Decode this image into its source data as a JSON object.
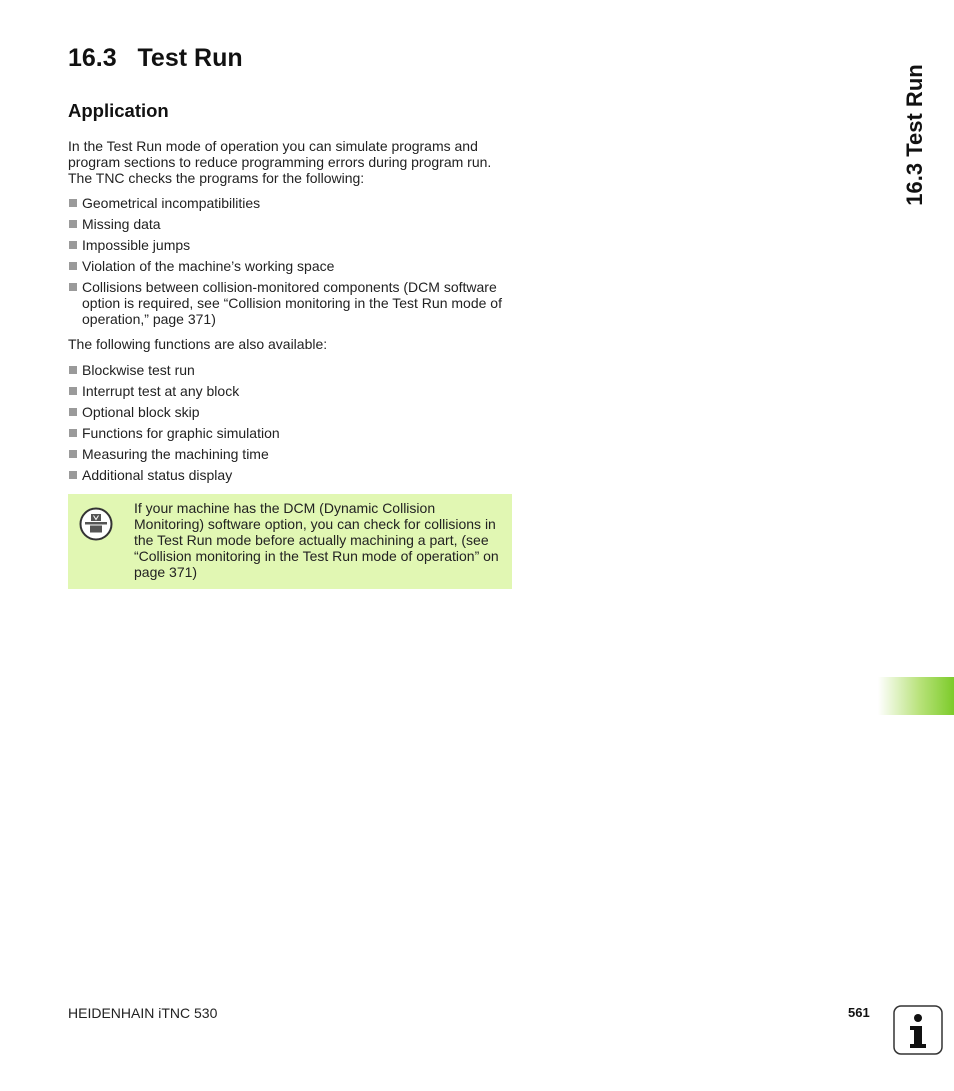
{
  "chapter": {
    "number": "16.3",
    "title": "Test Run"
  },
  "section": {
    "title": "Application"
  },
  "intro": "In the Test Run mode of operation you can simulate programs and program sections to reduce programming errors during program run. The TNC checks the programs for the following:",
  "checks": [
    {
      "label": "Geometrical incompatibilities"
    },
    {
      "label": "Missing data"
    },
    {
      "label": "Impossible jumps"
    },
    {
      "label": "Violation of the machine’s working space"
    },
    {
      "label": "Collisions between collision-monitored components (DCM software option is required, see “Collision monitoring in the Test Run mode of operation,” page 371)"
    }
  ],
  "also_available": "The following functions are also available:",
  "functions": [
    {
      "label": "Blockwise test run"
    },
    {
      "label": "Interrupt test at any block"
    },
    {
      "label": "Optional block skip"
    },
    {
      "label": "Functions for graphic simulation"
    },
    {
      "label": "Measuring the machining time"
    },
    {
      "label": "Additional status display"
    }
  ],
  "note": {
    "icon": "machine-dependent-icon",
    "text": "If your machine has the DCM (Dynamic Collision Monitoring) software option, you can check for collisions in the Test Run mode before actually machining a part, (see “Collision monitoring in the Test Run mode of operation” on page 371)",
    "background": "#e1f7b3"
  },
  "side_tab": {
    "label": "16.3 Test Run"
  },
  "thumb_tab": {
    "color": "#7ccb2a"
  },
  "footer": {
    "product": "HEIDENHAIN iTNC 530",
    "page_number": "561",
    "icon": "info-icon"
  }
}
